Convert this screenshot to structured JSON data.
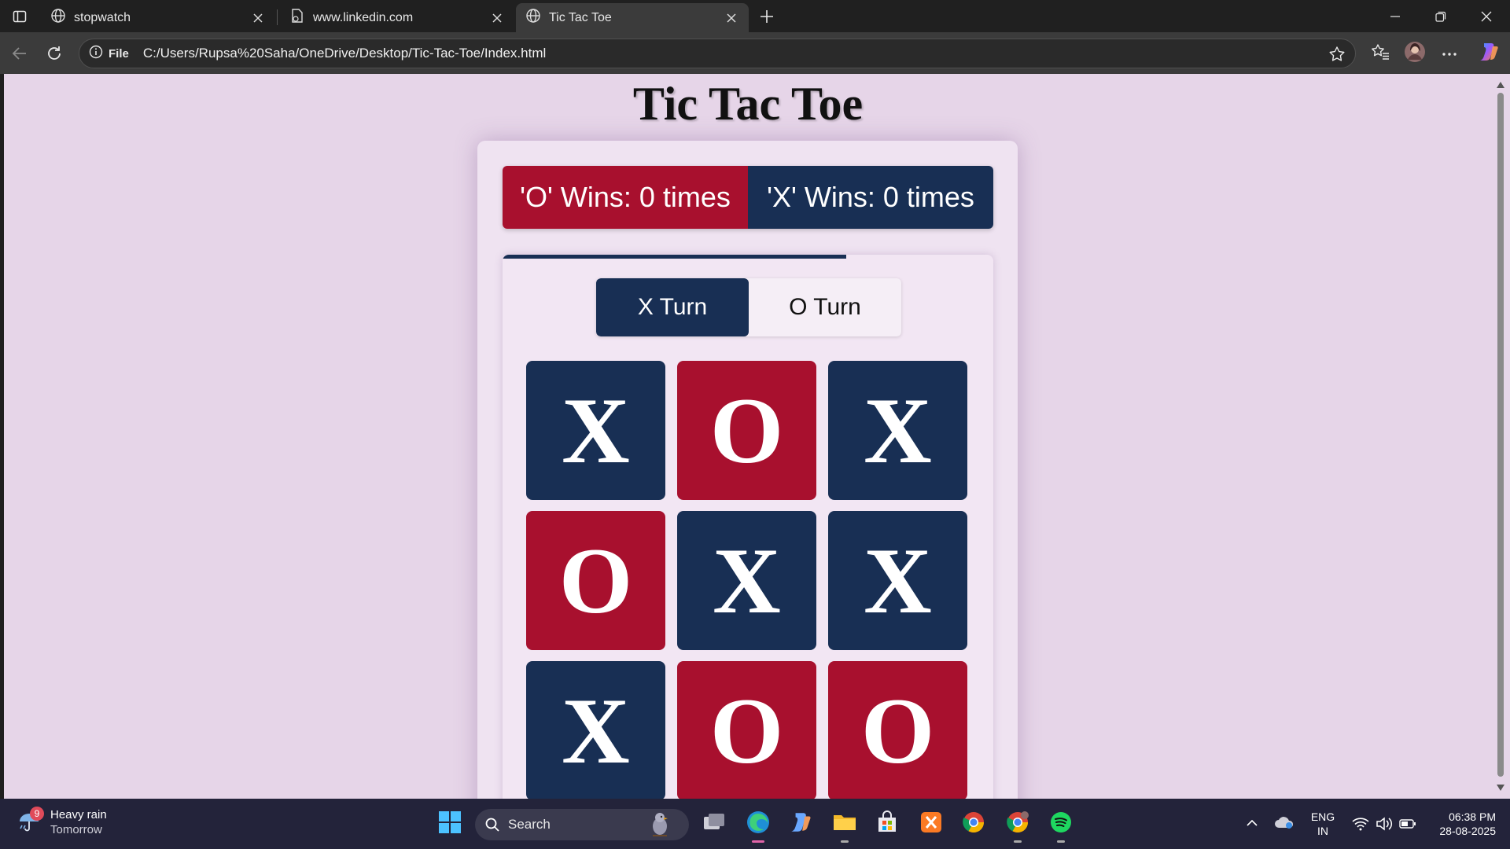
{
  "browser": {
    "tabs": [
      {
        "title": "stopwatch",
        "icon": "globe-icon",
        "active": false
      },
      {
        "title": "www.linkedin.com",
        "icon": "page-icon",
        "active": false
      },
      {
        "title": "Tic Tac Toe",
        "icon": "globe-icon",
        "active": true
      }
    ],
    "address": {
      "scheme_label": "File",
      "url": "C:/Users/Rupsa%20Saha/OneDrive/Desktop/Tic-Tac-Toe/Index.html"
    }
  },
  "page": {
    "title": "Tic Tac Toe",
    "score": {
      "o_label": "'O' Wins: 0 times",
      "x_label": "'X' Wins: 0 times"
    },
    "progress_fraction": 0.7,
    "turns": {
      "x_label": "X Turn",
      "o_label": "O Turn",
      "active": "X"
    },
    "board": [
      "X",
      "O",
      "X",
      "O",
      "X",
      "X",
      "X",
      "O",
      "O"
    ]
  },
  "taskbar": {
    "weather": {
      "badge": "9",
      "line1": "Heavy rain",
      "line2": "Tomorrow"
    },
    "search_label": "Search",
    "language": {
      "line1": "ENG",
      "line2": "IN"
    },
    "clock": {
      "time": "06:38 PM",
      "date": "28-08-2025"
    }
  },
  "colors": {
    "x_cell": "#182f54",
    "o_cell": "#a8102e",
    "page_background": "#e6d5e8"
  }
}
